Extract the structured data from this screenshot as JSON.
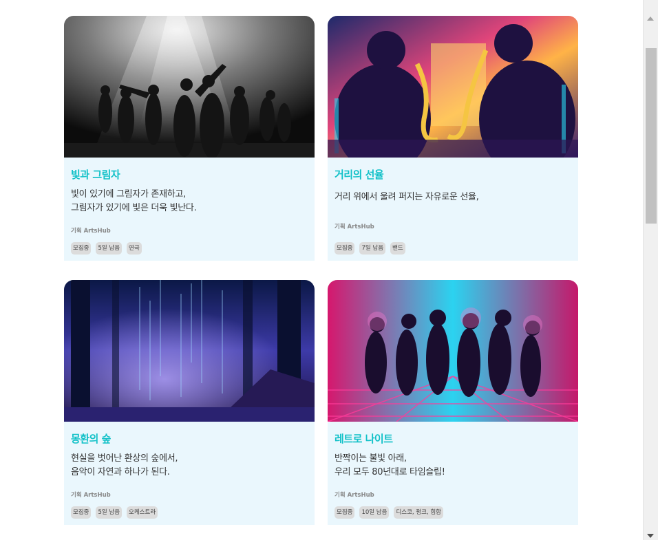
{
  "cards": [
    {
      "title": "빛과 그림자",
      "description": "빛이 있기에 그림자가 존재하고,\n그림자가 있기에 빛은 더욱 빛난다.",
      "organizer": "기획 ArtsHub",
      "tags": [
        "모집중",
        "5일 남음",
        "연극"
      ],
      "image_icon": "monochrome-dancers-image"
    },
    {
      "title": "거리의 선율",
      "description": "거리 위에서 울려 퍼지는 자유로운 선율,",
      "organizer": "기획 ArtsHub",
      "tags": [
        "모집중",
        "7일 남음",
        "밴드"
      ],
      "image_icon": "neon-saxophone-players-image"
    },
    {
      "title": "몽환의 숲",
      "description": "현실을 벗어난 환상의 숲에서,\n음악이 자연과 하나가 된다.",
      "organizer": "기획 ArtsHub",
      "tags": [
        "모집중",
        "5일 남음",
        "오케스트라"
      ],
      "image_icon": "mystic-forest-image"
    },
    {
      "title": "레트로 나이트",
      "description": "반짝이는 불빛 아래,\n우리 모두 80년대로 타임슬립!",
      "organizer": "기획 ArtsHub",
      "tags": [
        "모집중",
        "10일 남음",
        "디스코, 펑크, 힙합"
      ],
      "image_icon": "retro-disco-dancers-image"
    }
  ],
  "colors": {
    "title": "#12c1c8",
    "card_body_bg": "#eaf7fd",
    "tag_bg": "#dcdcdc"
  }
}
